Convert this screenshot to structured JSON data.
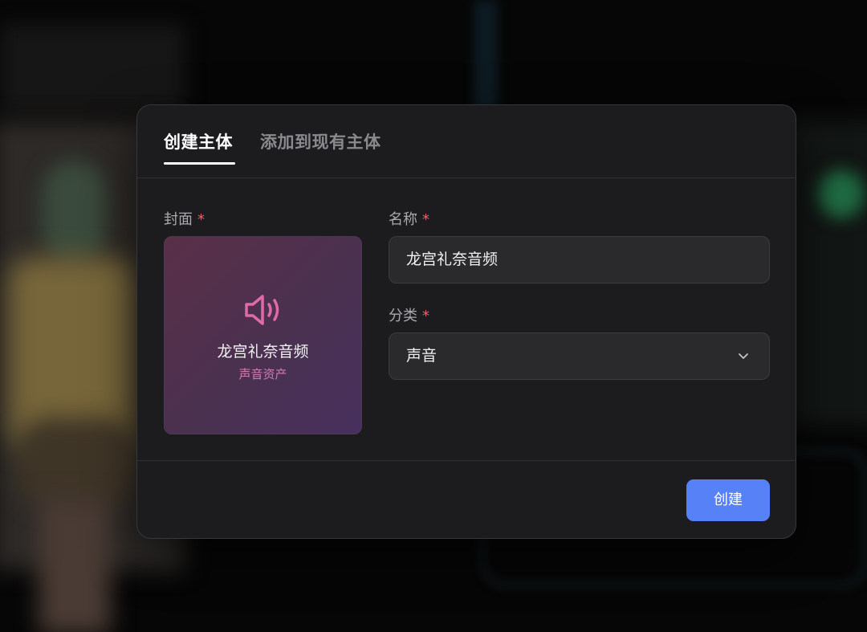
{
  "dialog": {
    "tabs": [
      {
        "label": "创建主体",
        "active": true
      },
      {
        "label": "添加到现有主体",
        "active": false
      }
    ],
    "cover": {
      "label": "封面",
      "required_mark": "*",
      "icon": "speaker-icon",
      "title": "龙宫礼奈音频",
      "subtitle": "声音资产"
    },
    "name": {
      "label": "名称",
      "required_mark": "*",
      "value": "龙宫礼奈音频"
    },
    "category": {
      "label": "分类",
      "required_mark": "*",
      "value": "声音"
    },
    "create_label": "创建"
  },
  "colors": {
    "accent": "#5782f7",
    "required": "#e5676b",
    "icon_pink": "#e06aa8"
  }
}
